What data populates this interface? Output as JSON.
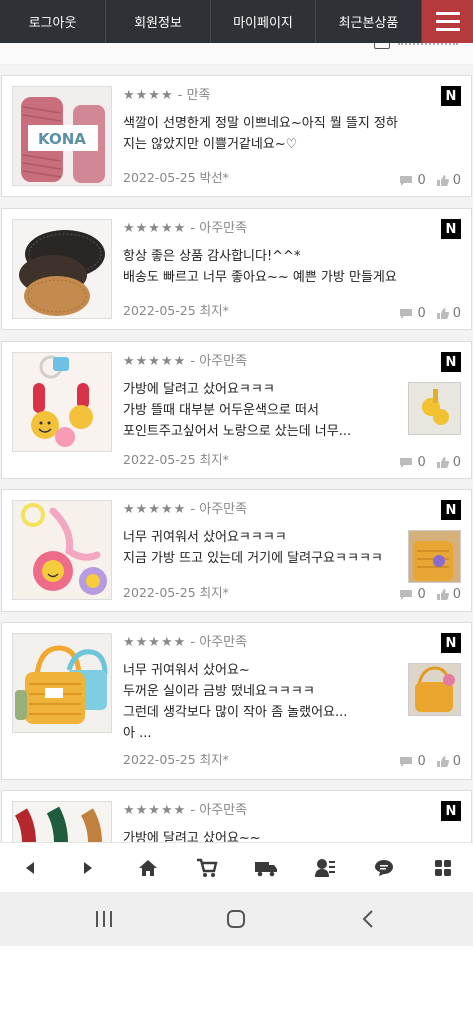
{
  "nav": {
    "items": [
      "로그아웃",
      "회원정보",
      "마이페이지",
      "최근본상품"
    ],
    "menu_icon": "hamburger-icon",
    "accent": "#b43a3e",
    "bg": "#2e3236"
  },
  "reviews": [
    {
      "stars": "★★★★",
      "rating_text": "- 만족",
      "badge": "N",
      "lines": [
        "색깔이 선명한게 정말 이쁘네요~아직 뭘 뜰지 정하",
        "지는 않았지만 이쁠거같네요~♡"
      ],
      "date": "2022-05-25",
      "author": "박선*",
      "comments": "0",
      "likes": "0"
    },
    {
      "stars": "★★★★★",
      "rating_text": "- 아주만족",
      "badge": "N",
      "lines": [
        "항상 좋은 상품 감사합니다!^^*",
        "배송도 빠르고 너무 좋아요~~ 예쁜 가방 만들게요"
      ],
      "date": "2022-05-25",
      "author": "최지*",
      "comments": "0",
      "likes": "0"
    },
    {
      "stars": "★★★★★",
      "rating_text": "- 아주만족",
      "badge": "N",
      "lines": [
        "가방에 달려고 샀어요ㅋㅋㅋ",
        "가방 뜰때 대부분 어두운색으로 떠서",
        "포인트주고싶어서 노랑으로 샀는데 너무..."
      ],
      "date": "2022-05-25",
      "author": "최지*",
      "comments": "0",
      "likes": "0"
    },
    {
      "stars": "★★★★★",
      "rating_text": "- 아주만족",
      "badge": "N",
      "lines": [
        "너무 귀여워서 샀어요ㅋㅋㅋㅋ",
        "지금 가방 뜨고 있는데 거기에 달려구요ㅋㅋㅋㅋ"
      ],
      "date": "2022-05-25",
      "author": "최지*",
      "comments": "0",
      "likes": "0"
    },
    {
      "stars": "★★★★★",
      "rating_text": "- 아주만족",
      "badge": "N",
      "lines": [
        "너무 귀여워서 샀어요~",
        "두꺼운 실이라 금방 떴네요ㅋㅋㅋㅋ",
        "그런데 생각보다 많이 작아 좀 놀랬어요...",
        "아 ..."
      ],
      "date": "2022-05-25",
      "author": "최지*",
      "comments": "0",
      "likes": "0"
    },
    {
      "stars": "★★★★★",
      "rating_text": "- 아주만족",
      "badge": "N",
      "lines": [
        "가방에 달려고 샀어요~~"
      ]
    }
  ],
  "toolbar": {
    "icons": [
      "prev-icon",
      "next-icon",
      "home-icon",
      "cart-icon",
      "delivery-truck-icon",
      "my-account-icon",
      "chat-icon",
      "grid-menu-icon"
    ]
  },
  "system_nav": {
    "icons": [
      "recent-apps-icon",
      "home-circle-icon",
      "back-icon"
    ]
  }
}
